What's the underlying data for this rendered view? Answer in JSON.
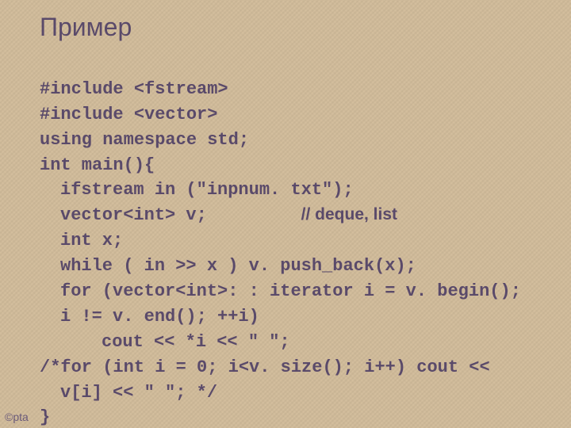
{
  "title": "Пример",
  "code": {
    "l1": "#include <fstream>",
    "l2": "#include <vector>",
    "l3": "using namespace std;",
    "l4": "int main(){",
    "l5": "ifstream in (\"inpnum. txt\");",
    "l6a": "vector<int> v;",
    "l6b": "// deque, list",
    "l7": "int x;",
    "l8": "while ( in >> x ) v. push_back(x);",
    "l9": "for (vector<int>: : iterator i = v. begin();",
    "l10": "i != v. end(); ++i)",
    "l11": "cout << *i << \" \";",
    "l12": "/*for (int i = 0; i<v. size(); i++) cout <<",
    "l13": "v[i] << \" \"; */",
    "l14": "}"
  },
  "footer": "©pta"
}
